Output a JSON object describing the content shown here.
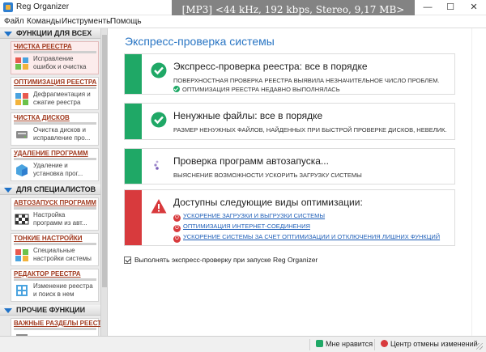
{
  "window": {
    "title": "Reg Organizer",
    "media_overlay": "[MP3] <44 kHz, 192 kbps, Stereo, 9,17 MB>",
    "minimize_glyph": "—",
    "maximize_glyph": "☐",
    "close_glyph": "✕"
  },
  "menu": {
    "items": [
      "Файл",
      "Команды",
      "Инструменты",
      "Помощь"
    ]
  },
  "sidebar": {
    "sections": [
      {
        "label": "ФУНКЦИИ ДЛЯ ВСЕХ",
        "items": [
          {
            "title": "ЧИСТКА РЕЕСТРА",
            "desc1": "Исправление",
            "desc2": "ошибок и очистка",
            "icon": "registry-cleaner-icon",
            "active": true
          },
          {
            "title": "ОПТИМИЗАЦИЯ РЕЕСТРА",
            "desc1": "Дефрагментация и",
            "desc2": "сжатие реестра",
            "icon": "registry-optimize-icon"
          },
          {
            "title": "ЧИСТКА ДИСКОВ",
            "desc1": "Очистка дисков и",
            "desc2": "исправление про...",
            "icon": "disk-cleanup-icon"
          },
          {
            "title": "УДАЛЕНИЕ ПРОГРАММ",
            "desc1": "Удаление и",
            "desc2": "установка прог...",
            "icon": "uninstall-icon"
          }
        ]
      },
      {
        "label": "ДЛЯ СПЕЦИАЛИСТОВ",
        "items": [
          {
            "title": "АВТОЗАПУСК ПРОГРАММ",
            "desc1": "Настройка",
            "desc2": "программ из авт...",
            "icon": "autorun-icon"
          },
          {
            "title": "ТОНКИЕ НАСТРОЙКИ",
            "desc1": "Специальные",
            "desc2": "настройки системы",
            "icon": "tweaks-icon"
          },
          {
            "title": "РЕДАКТОР РЕЕСТРА",
            "desc1": "Изменение реестра",
            "desc2": "и поиск в нем",
            "icon": "registry-editor-icon"
          }
        ]
      },
      {
        "label": "ПРОЧИЕ ФУНКЦИИ",
        "items": [
          {
            "title": "ВАЖНЫЕ РАЗДЕЛЫ РЕЕСТРА",
            "desc1": "",
            "desc2": "",
            "icon": "important-keys-icon"
          }
        ]
      }
    ]
  },
  "main": {
    "title": "Экспресс-проверка системы",
    "cards": [
      {
        "status": "ok",
        "title": "Экспресс-проверка реестра: все в порядке",
        "lines": [
          "Поверхностная проверка реестра выявила незначительное число проблем.",
          "Оптимизация реестра недавно выполнялась"
        ]
      },
      {
        "status": "ok",
        "title": "Ненужные файлы: все в порядке",
        "lines": [
          "Размер ненужных файлов, найденных при быстрой проверке дисков, невелик."
        ]
      },
      {
        "status": "loading",
        "title": "Проверка программ автозапуска...",
        "lines": [
          "Выяснение возможности ускорить загрузку системы"
        ]
      },
      {
        "status": "warning",
        "title": "Доступны следующие виды оптимизации:",
        "links": [
          "Ускорение загрузки и выгрузки системы",
          "Оптимизация интернет-соединения",
          "Ускорение системы за счет оптимизации и отключения лишних функций"
        ]
      }
    ],
    "checkbox_label": "Выполнять экспресс-проверку при запуске Reg Organizer",
    "checkbox_checked": true
  },
  "statusbar": {
    "like_label": "Мне нравится",
    "undo_label": "Центр отмены изменений"
  },
  "colors": {
    "accent": "#2a76c4",
    "ok": "#1fa866",
    "warning": "#d83a3d",
    "link": "#1f5fb8",
    "sidebar_title": "#a13a1f"
  }
}
